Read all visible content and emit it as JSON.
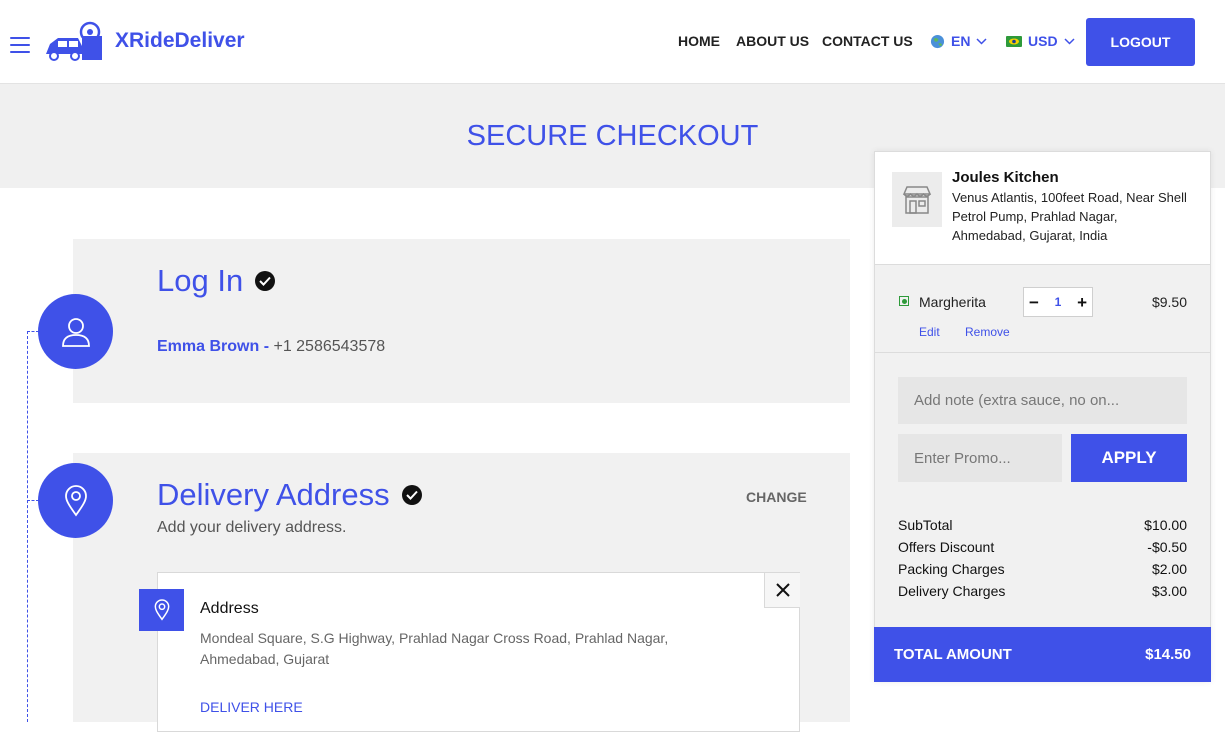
{
  "header": {
    "brand": "XRideDeliver",
    "nav": [
      "HOME",
      "ABOUT US",
      "CONTACT US"
    ],
    "language": "EN",
    "currency": "USD",
    "logout_label": "LOGOUT"
  },
  "page_title": "SECURE CHECKOUT",
  "login": {
    "title": "Log In",
    "user_name": "Emma Brown -",
    "phone": "+1 2586543578"
  },
  "delivery": {
    "title": "Delivery Address",
    "subtitle": "Add your delivery address.",
    "change_label": "CHANGE",
    "address_heading": "Address",
    "address_text": "Mondeal Square, S.G Highway, Prahlad Nagar Cross Road, Prahlad Nagar, Ahmedabad, Gujarat",
    "deliver_here_label": "DELIVER HERE"
  },
  "cart": {
    "restaurant_name": "Joules Kitchen",
    "restaurant_address": "Venus Atlantis, 100feet Road, Near Shell Petrol Pump, Prahlad Nagar, Ahmedabad, Gujarat, India",
    "item": {
      "name": "Margherita",
      "quantity": "1",
      "price": "$9.50",
      "edit_label": "Edit",
      "remove_label": "Remove"
    },
    "note_placeholder": "Add note (extra sauce, no on...",
    "promo_placeholder": "Enter Promo...",
    "apply_label": "APPLY",
    "summary": [
      {
        "label": "SubTotal",
        "value": "$10.00"
      },
      {
        "label": "Offers Discount",
        "value": "-$0.50"
      },
      {
        "label": "Packing Charges",
        "value": "$2.00"
      },
      {
        "label": "Delivery Charges",
        "value": "$3.00"
      }
    ],
    "total_label": "TOTAL AMOUNT",
    "total_value": "$14.50"
  },
  "colors": {
    "accent": "#3f51e8",
    "panel_bg": "#f1f1f1"
  }
}
